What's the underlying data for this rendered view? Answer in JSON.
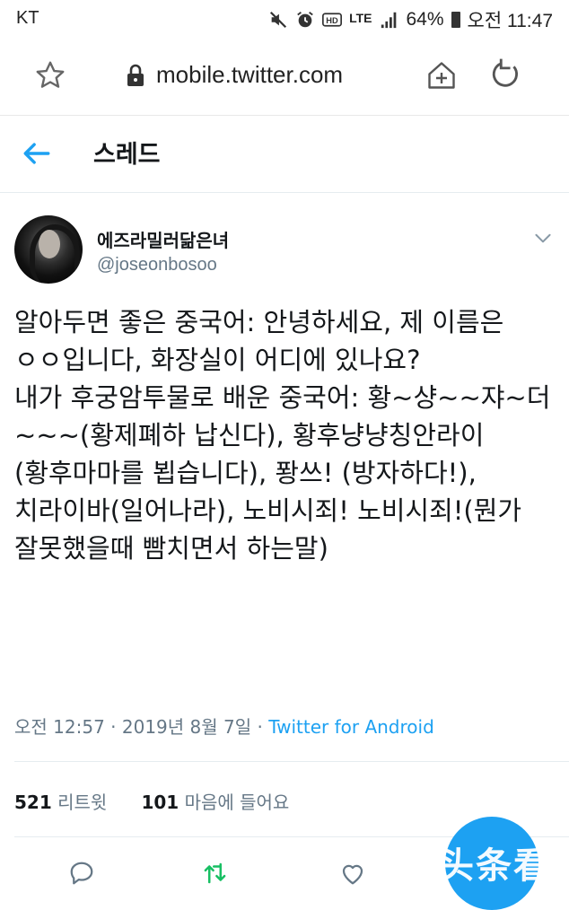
{
  "status_bar": {
    "carrier": "KT",
    "lte": "LTE",
    "battery": "64%",
    "time": "오전 11:47"
  },
  "browser": {
    "url": "mobile.twitter.com"
  },
  "header": {
    "title": "스레드"
  },
  "tweet": {
    "display_name": "에즈라밀러닮은녀",
    "username": "@joseonbosoo",
    "body": "알아두면 좋은 중국어: 안녕하세요, 제 이름은 ㅇㅇ입니다, 화장실이 어디에 있나요?\n내가 후궁암투물로 배운 중국어: 황~샹~~쟈~더~~~(황제폐하 납신다), 황후냥냥칭안라이(황후마마를 뵙습니다), 퐝쓰! (방자하다!), 치라이바(일어나라), 노비시죄! 노비시죄!(뭔가 잘못했을때 빰치면서 하는말)",
    "timestamp": "오전 12:57 · 2019년 8월 7일 · ",
    "source": "Twitter for Android",
    "retweet_count": "521",
    "retweet_label": " 리트윗",
    "like_count": "101",
    "like_label": " 마음에 들어요"
  },
  "watermark": "头条看点",
  "colors": {
    "accent": "#1da1f2",
    "secondary_text": "#657786",
    "retweet_green": "#17bf63"
  },
  "icons": [
    "star-icon",
    "lock-icon",
    "add-to-home-icon",
    "reload-icon",
    "back-arrow-icon",
    "chevron-down-icon",
    "reply-icon",
    "retweet-icon",
    "like-icon",
    "mute-icon",
    "alarm-icon",
    "hd-icon",
    "signal-icon"
  ]
}
